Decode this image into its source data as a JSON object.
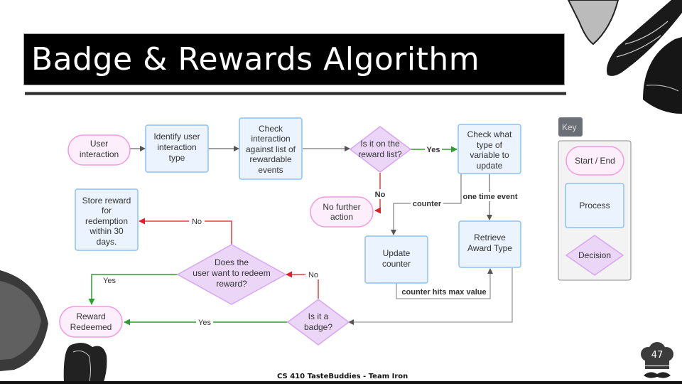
{
  "slide": {
    "title": "Badge & Rewards Algorithm",
    "footer": "CS 410 TasteBuddies - Team Iron",
    "page_number": "47"
  },
  "colors": {
    "start_end_fill": "#fdeefc",
    "start_end_stroke": "#f39bdd",
    "process_fill": "#eaf3fe",
    "process_stroke": "#8cc1f3",
    "decision_fill": "#ecd6f8",
    "decision_stroke": "#d8a6ef",
    "edge_default": "#888888",
    "edge_yes": "#2e9e2e",
    "edge_no": "#e0403a",
    "key_header_fill": "#6b6f76",
    "key_panel_fill": "#f3f3f4"
  },
  "diagram": {
    "nodes": {
      "user_interaction": {
        "type": "start_end",
        "lines": [
          "User",
          "interaction"
        ]
      },
      "identify_type": {
        "type": "process",
        "lines": [
          "Identify user",
          "interaction",
          "type"
        ]
      },
      "check_interaction": {
        "type": "process",
        "lines": [
          "Check",
          "interaction",
          "against list of",
          "rewardable",
          "events"
        ]
      },
      "on_reward_list": {
        "type": "decision",
        "lines": [
          "Is it on the",
          "reward list?"
        ]
      },
      "check_variable": {
        "type": "process",
        "lines": [
          "Check what",
          "type of",
          "variable to",
          "update"
        ]
      },
      "no_further_action": {
        "type": "start_end",
        "lines": [
          "No further",
          "action"
        ]
      },
      "update_counter": {
        "type": "process",
        "lines": [
          "Update",
          "counter"
        ]
      },
      "retrieve_award": {
        "type": "process",
        "lines": [
          "Retrieve",
          "Award Type"
        ]
      },
      "is_badge": {
        "type": "decision",
        "lines": [
          "Is it a",
          "badge?"
        ]
      },
      "want_redeem": {
        "type": "decision",
        "lines": [
          "Does the",
          "user want to redeem",
          "reward?"
        ]
      },
      "store_reward": {
        "type": "process",
        "lines": [
          "Store reward",
          "for",
          "redemption",
          "within 30",
          "days."
        ]
      },
      "reward_redeemed": {
        "type": "start_end",
        "lines": [
          "Reward",
          "Redeemed"
        ]
      }
    },
    "edges": [
      {
        "from": "user_interaction",
        "to": "identify_type",
        "label": "",
        "kind": "default"
      },
      {
        "from": "identify_type",
        "to": "check_interaction",
        "label": "",
        "kind": "default"
      },
      {
        "from": "check_interaction",
        "to": "on_reward_list",
        "label": "",
        "kind": "default"
      },
      {
        "from": "on_reward_list",
        "to": "check_variable",
        "label": "Yes",
        "kind": "yes"
      },
      {
        "from": "on_reward_list",
        "to": "no_further_action",
        "label": "No",
        "kind": "no"
      },
      {
        "from": "check_variable",
        "to": "update_counter",
        "label": "counter",
        "kind": "default"
      },
      {
        "from": "check_variable",
        "to": "retrieve_award",
        "label": "one time event",
        "kind": "default"
      },
      {
        "from": "update_counter",
        "to": "retrieve_award",
        "label": "counter hits max value",
        "kind": "default"
      },
      {
        "from": "retrieve_award",
        "to": "is_badge",
        "label": "",
        "kind": "default"
      },
      {
        "from": "is_badge",
        "to": "reward_redeemed",
        "label": "Yes",
        "kind": "yes"
      },
      {
        "from": "is_badge",
        "to": "want_redeem",
        "label": "No",
        "kind": "no"
      },
      {
        "from": "want_redeem",
        "to": "store_reward",
        "label": "No",
        "kind": "no"
      },
      {
        "from": "want_redeem",
        "to": "reward_redeemed",
        "label": "Yes",
        "kind": "yes"
      }
    ]
  },
  "key": {
    "header": "Key",
    "items": [
      {
        "type": "start_end",
        "label": "Start / End"
      },
      {
        "type": "process",
        "label": "Process"
      },
      {
        "type": "decision",
        "label": "Decision"
      }
    ]
  }
}
